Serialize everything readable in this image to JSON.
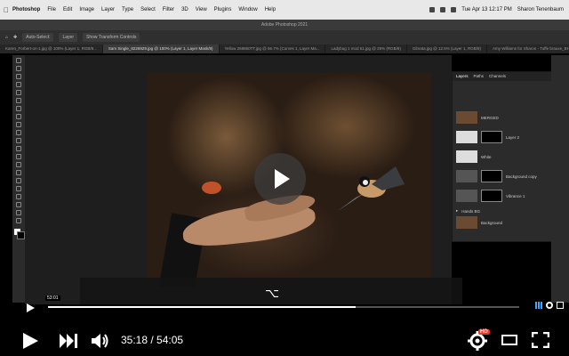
{
  "menubar": {
    "app": "Photoshop",
    "menus": [
      "File",
      "Edit",
      "Image",
      "Layer",
      "Type",
      "Select",
      "Filter",
      "3D",
      "View",
      "Plugins",
      "Window",
      "Help"
    ],
    "clock": "Tue Apr 13  12:17 PM",
    "user": "Sharon Tenenbaum"
  },
  "photoshop": {
    "window_title": "Adobe Photoshop 2021",
    "options": [
      "Auto-Select:",
      "Layer",
      "Show Transform Controls"
    ],
    "tabs": [
      "Karen_Forbert-on-1.jpg @ 100% (Layer 1, RGB/8...",
      "Sam Single_8226929.jpg @ 100% (Layer 1, Layer Mask/8)",
      "Yellow 268860TT.jpg @ 66.7% (Curves 1, Layer Ma...",
      "Ladybug 1 mod 51.jpg @ 25% (RGB/8)",
      "Gibrata.jpg @ 12.5% (Layer 1, RGB/8)",
      "Amy Williams for Sharon - Tuffe brauxe_BHI.psd"
    ],
    "layers_panel": {
      "tabs": [
        "Layers",
        "Paths",
        "Channels"
      ],
      "rows": [
        {
          "name": "MERGED"
        },
        {
          "name": "Layer 2"
        },
        {
          "name": "White"
        },
        {
          "name": "Background copy"
        },
        {
          "name": "Vibrance 1"
        },
        {
          "name": "Hands BG"
        },
        {
          "name": "Background"
        }
      ]
    }
  },
  "video": {
    "inner_time_tooltip": "53:01",
    "subtitle_glyph": "⌥",
    "current_time": "35:18",
    "duration": "54:05",
    "time_separator": " / ",
    "hd_badge": "HD",
    "progress_fraction": 0.652
  },
  "colors": {
    "accent_red": "#e53a2b",
    "hd_red": "#e53a2b",
    "menubar_bg": "#e8e8e8"
  }
}
